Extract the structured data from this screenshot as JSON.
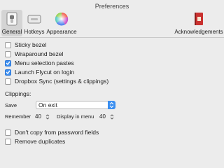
{
  "window": {
    "title": "Preferences"
  },
  "toolbar": {
    "items": [
      {
        "label": "General",
        "icon": "switch-icon",
        "selected": true
      },
      {
        "label": "Hotkeys",
        "icon": "keyboard-icon"
      },
      {
        "label": "Appearance",
        "icon": "color-wheel-icon"
      },
      {
        "label": "Acknowledgements",
        "icon": "book-icon"
      }
    ]
  },
  "options": [
    {
      "label": "Sticky bezel",
      "checked": false
    },
    {
      "label": "Wraparound bezel",
      "checked": false
    },
    {
      "label": "Menu selection pastes",
      "checked": true
    },
    {
      "label": "Launch Flycut on login",
      "checked": true
    },
    {
      "label": "Dropbox Sync (settings & clippings)",
      "checked": false
    }
  ],
  "clippings": {
    "title": "Clippings:",
    "save_label": "Save",
    "save_value": "On exit",
    "remember_label": "Remember",
    "remember_value": "40",
    "display_label": "Display in menu",
    "display_value": "40"
  },
  "privacy": [
    {
      "label": "Don't copy from password fields",
      "checked": false
    },
    {
      "label": "Remove duplicates",
      "checked": false
    }
  ],
  "colors": {
    "accent": "#3d8ff0"
  }
}
